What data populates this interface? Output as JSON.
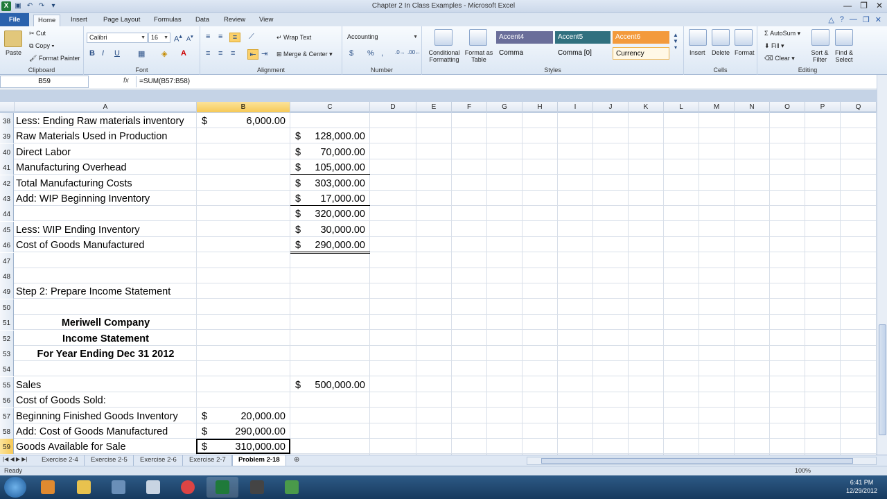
{
  "window": {
    "title": "Chapter 2 In Class Examples - Microsoft Excel"
  },
  "tabs": [
    "File",
    "Home",
    "Insert",
    "Page Layout",
    "Formulas",
    "Data",
    "Review",
    "View"
  ],
  "ribbon": {
    "clipboard": {
      "paste": "Paste",
      "cut": "Cut",
      "copy": "Copy",
      "format_painter": "Format Painter",
      "label": "Clipboard"
    },
    "font": {
      "name": "Calibri",
      "size": "16",
      "label": "Font"
    },
    "alignment": {
      "wrap": "Wrap Text",
      "merge": "Merge & Center",
      "label": "Alignment"
    },
    "number": {
      "format": "Accounting",
      "dollar": "$",
      "percent": "%",
      "comma": ",",
      "label": "Number"
    },
    "styles": {
      "conditional": "Conditional Formatting",
      "format_table": "Format as Table",
      "accent4": "Accent4",
      "accent5": "Accent5",
      "accent6": "Accent6",
      "comma": "Comma",
      "comma0": "Comma [0]",
      "currency": "Currency",
      "label": "Styles"
    },
    "cells": {
      "insert": "Insert",
      "delete": "Delete",
      "format": "Format",
      "label": "Cells"
    },
    "editing": {
      "autosum": "AutoSum",
      "fill": "Fill",
      "clear": "Clear",
      "sort": "Sort & Filter",
      "find": "Find & Select",
      "label": "Editing"
    }
  },
  "formula_bar": {
    "name_box": "B59",
    "fx": "fx",
    "formula": "=SUM(B57:B58)"
  },
  "columns": [
    "A",
    "B",
    "C",
    "D",
    "E",
    "F",
    "G",
    "H",
    "I",
    "J",
    "K",
    "L",
    "M",
    "N",
    "O",
    "P",
    "Q"
  ],
  "rows": [
    {
      "n": "38",
      "a": "Less: Ending Raw materials inventory",
      "b": "6,000.00"
    },
    {
      "n": "39",
      "a": "Raw Materials Used in Production",
      "c": "128,000.00"
    },
    {
      "n": "40",
      "a": "Direct Labor",
      "c": "70,000.00"
    },
    {
      "n": "41",
      "a": "Manufacturing Overhead",
      "c": "105,000.00"
    },
    {
      "n": "42",
      "a": "Total Manufacturing Costs",
      "c": "303,000.00"
    },
    {
      "n": "43",
      "a": "Add: WIP Beginning Inventory",
      "c": "17,000.00"
    },
    {
      "n": "44",
      "a": "",
      "c": "320,000.00"
    },
    {
      "n": "45",
      "a": "Less: WIP Ending Inventory",
      "c": "30,000.00"
    },
    {
      "n": "46",
      "a": "Cost of Goods Manufactured",
      "c": "290,000.00"
    },
    {
      "n": "47",
      "a": ""
    },
    {
      "n": "48",
      "a": ""
    },
    {
      "n": "49",
      "a": "Step 2: Prepare Income Statement"
    },
    {
      "n": "50",
      "a": ""
    },
    {
      "n": "51",
      "a": "Meriwell Company"
    },
    {
      "n": "52",
      "a": "Income Statement"
    },
    {
      "n": "53",
      "a": "For Year Ending Dec 31 2012"
    },
    {
      "n": "54",
      "a": ""
    },
    {
      "n": "55",
      "a": "Sales",
      "c": "500,000.00"
    },
    {
      "n": "56",
      "a": "Cost of Goods Sold:"
    },
    {
      "n": "57",
      "a": "Beginning Finished Goods Inventory",
      "b": "20,000.00"
    },
    {
      "n": "58",
      "a": "Add: Cost of Goods Manufactured",
      "b": "290,000.00"
    },
    {
      "n": "59",
      "a": "Goods Available for Sale",
      "b": "310,000.00"
    }
  ],
  "currency_symbol": "$",
  "sheets": [
    "Exercise 2-4",
    "Exercise 2-5",
    "Exercise 2-6",
    "Exercise 2-7",
    "Problem 2-18"
  ],
  "status": {
    "ready": "Ready",
    "zoom": "100%"
  },
  "clock": {
    "time": "6:41 PM",
    "date": "12/29/2012"
  }
}
